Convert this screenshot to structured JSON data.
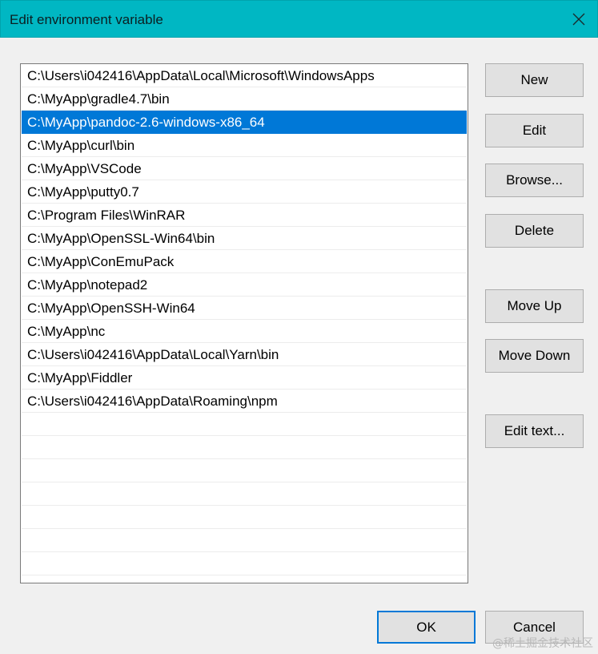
{
  "window": {
    "title": "Edit environment variable",
    "close_icon": "close-icon"
  },
  "paths": {
    "selected_index": 2,
    "empty_rows": 7,
    "items": [
      "C:\\Users\\i042416\\AppData\\Local\\Microsoft\\WindowsApps",
      "C:\\MyApp\\gradle4.7\\bin",
      "C:\\MyApp\\pandoc-2.6-windows-x86_64",
      "C:\\MyApp\\curl\\bin",
      "C:\\MyApp\\VSCode",
      "C:\\MyApp\\putty0.7",
      "C:\\Program Files\\WinRAR",
      "C:\\MyApp\\OpenSSL-Win64\\bin",
      "C:\\MyApp\\ConEmuPack",
      "C:\\MyApp\\notepad2",
      "C:\\MyApp\\OpenSSH-Win64",
      "C:\\MyApp\\nc",
      "C:\\Users\\i042416\\AppData\\Local\\Yarn\\bin",
      "C:\\MyApp\\Fiddler",
      "C:\\Users\\i042416\\AppData\\Roaming\\npm"
    ]
  },
  "buttons": {
    "new": "New",
    "edit": "Edit",
    "browse": "Browse...",
    "delete": "Delete",
    "move_up": "Move Up",
    "move_down": "Move Down",
    "edit_text": "Edit text...",
    "ok": "OK",
    "cancel": "Cancel"
  },
  "watermark": "@稀土掘金技术社区",
  "colors": {
    "titlebar": "#00b7c3",
    "selection": "#0078d7",
    "button_face": "#e1e1e1",
    "default_button_border": "#0078d7"
  }
}
